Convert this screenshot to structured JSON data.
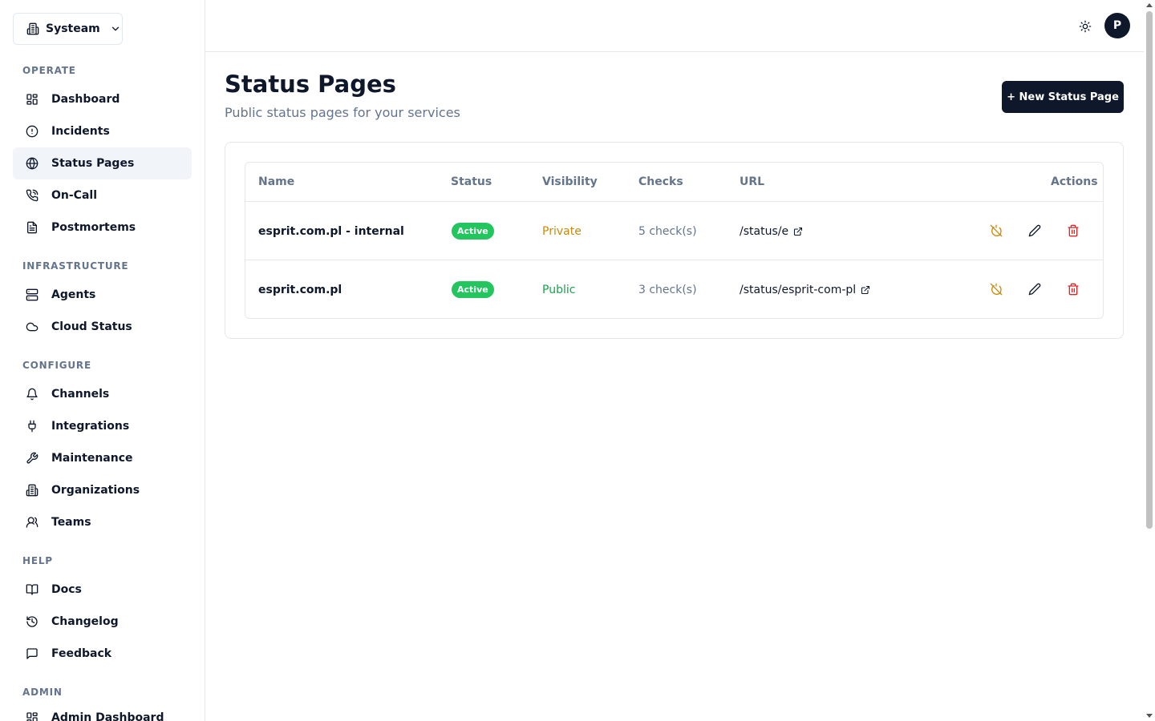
{
  "org": {
    "name": "Systeam"
  },
  "sidebar": {
    "sections": [
      {
        "label": "OPERATE",
        "items": [
          {
            "label": "Dashboard",
            "icon": "dashboard-icon"
          },
          {
            "label": "Incidents",
            "icon": "alert-circle-icon"
          },
          {
            "label": "Status Pages",
            "icon": "globe-icon",
            "active": true
          },
          {
            "label": "On-Call",
            "icon": "phone-icon"
          },
          {
            "label": "Postmortems",
            "icon": "file-text-icon"
          }
        ]
      },
      {
        "label": "INFRASTRUCTURE",
        "items": [
          {
            "label": "Agents",
            "icon": "server-icon"
          },
          {
            "label": "Cloud Status",
            "icon": "cloud-icon"
          }
        ]
      },
      {
        "label": "CONFIGURE",
        "items": [
          {
            "label": "Channels",
            "icon": "bell-icon"
          },
          {
            "label": "Integrations",
            "icon": "plug-icon"
          },
          {
            "label": "Maintenance",
            "icon": "wrench-icon"
          },
          {
            "label": "Organizations",
            "icon": "building-icon"
          },
          {
            "label": "Teams",
            "icon": "users-icon"
          }
        ]
      },
      {
        "label": "HELP",
        "items": [
          {
            "label": "Docs",
            "icon": "book-icon"
          },
          {
            "label": "Changelog",
            "icon": "history-icon"
          },
          {
            "label": "Feedback",
            "icon": "message-icon"
          }
        ]
      },
      {
        "label": "ADMIN",
        "items": [
          {
            "label": "Admin Dashboard",
            "icon": "dashboard-icon"
          }
        ]
      }
    ]
  },
  "header": {
    "avatar_initial": "P"
  },
  "page": {
    "title": "Status Pages",
    "subtitle": "Public status pages for your services",
    "new_button": "+ New Status Page"
  },
  "table": {
    "columns": {
      "name": "Name",
      "status": "Status",
      "visibility": "Visibility",
      "checks": "Checks",
      "url": "URL",
      "actions": "Actions"
    },
    "rows": [
      {
        "name": "esprit.com.pl - internal",
        "status": "Active",
        "visibility": "Private",
        "checks": "5 check(s)",
        "url": "/status/e"
      },
      {
        "name": "esprit.com.pl",
        "status": "Active",
        "visibility": "Public",
        "checks": "3 check(s)",
        "url": "/status/esprit-com-pl"
      }
    ]
  },
  "colors": {
    "primary": "#0f172a",
    "active_badge": "#22c55e",
    "private": "#ca8a04",
    "public": "#16a34a",
    "delete": "#dc2626",
    "disable": "#ca8a04"
  }
}
